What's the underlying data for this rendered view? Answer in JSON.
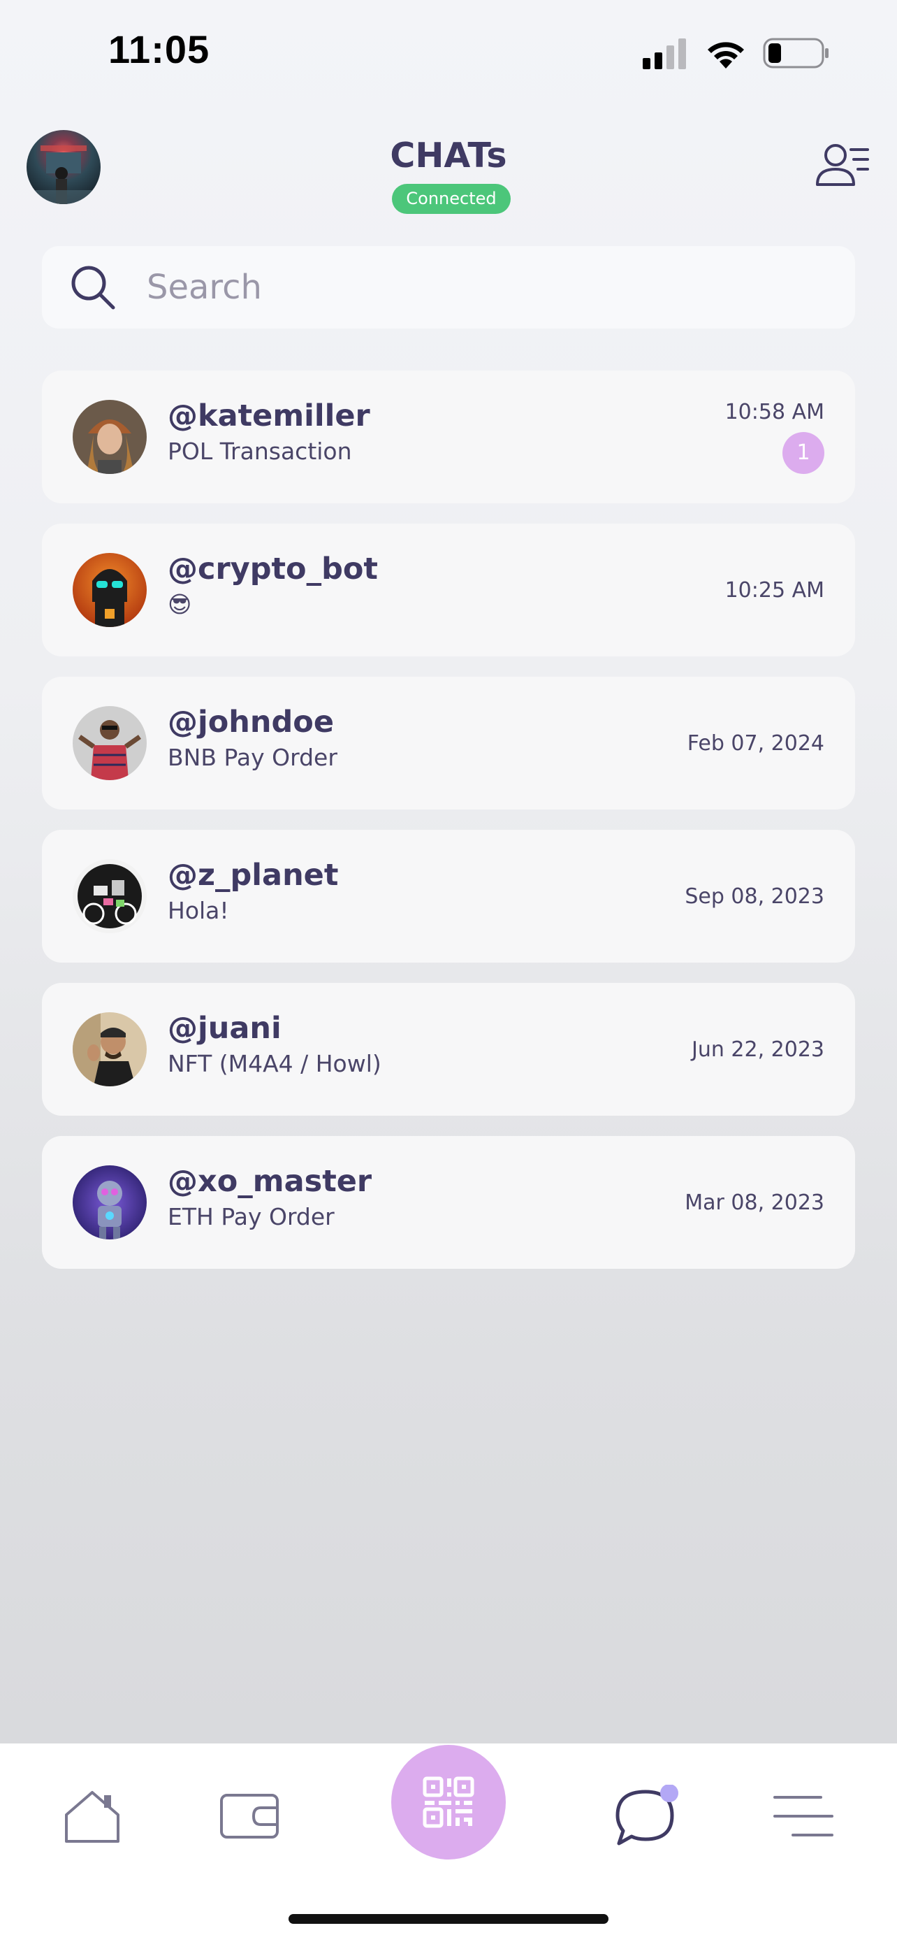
{
  "status_bar": {
    "time": "11:05",
    "icons": [
      "cellular-signal-icon",
      "wifi-icon",
      "battery-icon"
    ]
  },
  "header": {
    "title": "CHATs",
    "connection_status": "Connected",
    "status_color": "#4cc67a"
  },
  "search": {
    "placeholder": "Search",
    "value": ""
  },
  "chats": [
    {
      "username": "@katemiller",
      "preview": "POL Transaction",
      "time": "10:58 AM",
      "unread": "1"
    },
    {
      "username": "@crypto_bot",
      "preview": "😎",
      "time": "10:25 AM",
      "unread": ""
    },
    {
      "username": "@johndoe",
      "preview": "BNB Pay Order",
      "time": "Feb 07, 2024",
      "unread": ""
    },
    {
      "username": "@z_planet",
      "preview": "Hola!",
      "time": "Sep 08, 2023",
      "unread": ""
    },
    {
      "username": "@juani",
      "preview": "NFT (M4A4 / Howl)",
      "time": "Jun 22, 2023",
      "unread": ""
    },
    {
      "username": "@xo_master",
      "preview": "ETH Pay Order",
      "time": "Mar 08, 2023",
      "unread": ""
    }
  ],
  "bottom_nav": {
    "items": [
      "home-icon",
      "wallet-icon",
      "qr-code-icon",
      "chat-icon",
      "menu-icon"
    ],
    "active": "chat-icon"
  },
  "colors": {
    "accent": "#dcacee",
    "text": "#3f3a63",
    "notification_dot": "#b3a8f5"
  }
}
